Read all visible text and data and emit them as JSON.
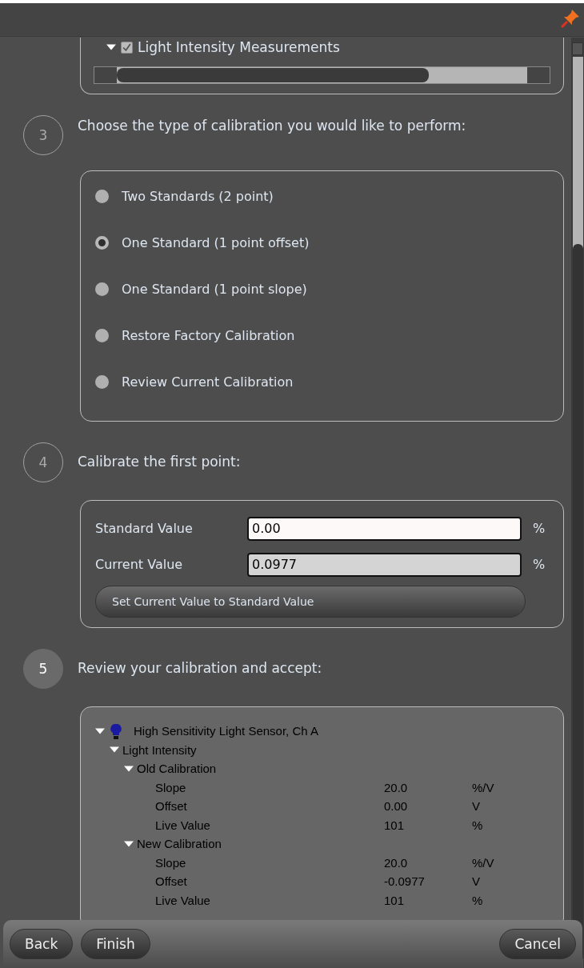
{
  "measurement_tree": {
    "items": [
      {
        "label": "Light Intensity Measurements",
        "checked": true,
        "expanded": true
      }
    ]
  },
  "steps": [
    {
      "number": "3",
      "active": false,
      "title": "Choose the type of calibration you would like to perform:",
      "kind": "radios",
      "options": [
        {
          "label": "Two Standards (2 point)",
          "selected": false
        },
        {
          "label": "One Standard (1 point offset)",
          "selected": true
        },
        {
          "label": "One Standard (1 point slope)",
          "selected": false
        },
        {
          "label": "Restore Factory Calibration",
          "selected": false
        },
        {
          "label": "Review Current Calibration",
          "selected": false
        }
      ]
    },
    {
      "number": "4",
      "active": false,
      "title": "Calibrate the first point:",
      "kind": "fields",
      "fields": [
        {
          "label": "Standard Value",
          "value": "0.00",
          "unit": "%",
          "disabled": false
        },
        {
          "label": "Current Value",
          "value": "0.0977",
          "unit": "%",
          "disabled": true
        }
      ],
      "button": "Set Current Value to Standard Value"
    },
    {
      "number": "5",
      "active": true,
      "title": "Review your calibration and accept:",
      "kind": "review",
      "tree": [
        {
          "label": "High Sensitivity Light Sensor, Ch A",
          "expanded": true,
          "children": [
            {
              "label": "Light Intensity",
              "expanded": true,
              "children": [
                {
                  "label": "Old Calibration",
                  "expanded": true,
                  "rows": [
                    {
                      "name": "Slope",
                      "value": "20.0",
                      "unit": "%/V"
                    },
                    {
                      "name": "Offset",
                      "value": "0.00",
                      "unit": "V"
                    },
                    {
                      "name": "Live Value",
                      "value": "101",
                      "unit": "%"
                    }
                  ]
                },
                {
                  "label": "New Calibration",
                  "expanded": true,
                  "rows": [
                    {
                      "name": "Slope",
                      "value": "20.0",
                      "unit": "%/V"
                    },
                    {
                      "name": "Offset",
                      "value": "-0.0977",
                      "unit": "V"
                    },
                    {
                      "name": "Live Value",
                      "value": "101",
                      "unit": "%"
                    }
                  ]
                }
              ]
            }
          ]
        }
      ]
    }
  ],
  "footer": {
    "left_buttons": [
      "Back",
      "Finish"
    ],
    "right_buttons": [
      "Cancel"
    ]
  }
}
